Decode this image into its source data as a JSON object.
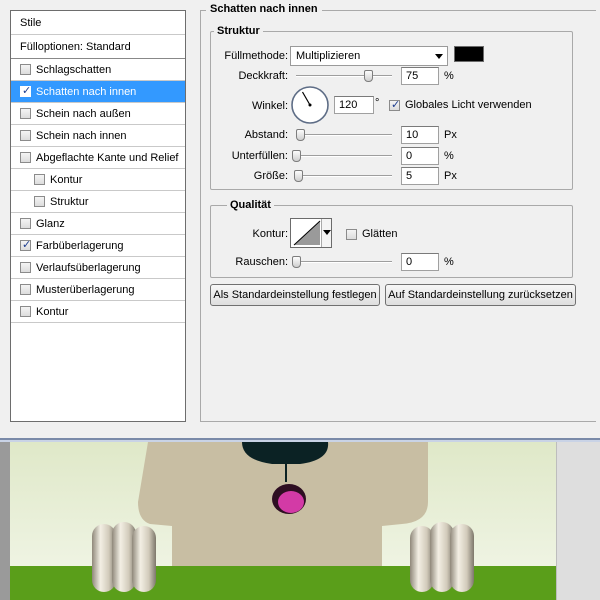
{
  "styles_panel": {
    "header": "Stile",
    "fill_options": "Fülloptionen: Standard",
    "items": [
      {
        "label": "Schlagschatten",
        "checked": false,
        "selected": false,
        "sub": false
      },
      {
        "label": "Schatten nach innen",
        "checked": true,
        "selected": true,
        "sub": false
      },
      {
        "label": "Schein nach außen",
        "checked": false,
        "selected": false,
        "sub": false
      },
      {
        "label": "Schein nach innen",
        "checked": false,
        "selected": false,
        "sub": false
      },
      {
        "label": "Abgeflachte Kante und Relief",
        "checked": false,
        "selected": false,
        "sub": false
      },
      {
        "label": "Kontur",
        "checked": false,
        "selected": false,
        "sub": true
      },
      {
        "label": "Struktur",
        "checked": false,
        "selected": false,
        "sub": true
      },
      {
        "label": "Glanz",
        "checked": false,
        "selected": false,
        "sub": false
      },
      {
        "label": "Farbüberlagerung",
        "checked": true,
        "selected": false,
        "sub": false
      },
      {
        "label": "Verlaufsüberlagerung",
        "checked": false,
        "selected": false,
        "sub": false
      },
      {
        "label": "Musterüberlagerung",
        "checked": false,
        "selected": false,
        "sub": false
      },
      {
        "label": "Kontur",
        "checked": false,
        "selected": false,
        "sub": false
      }
    ]
  },
  "inner_shadow": {
    "title": "Schatten nach innen",
    "structure": {
      "title": "Struktur",
      "blend_mode_label": "Füllmethode:",
      "blend_mode_value": "Multiplizieren",
      "shadow_color": "#000000",
      "opacity_label": "Deckkraft:",
      "opacity_value": "75",
      "opacity_unit": "%",
      "opacity_fraction": 0.75,
      "angle_label": "Winkel:",
      "angle_value": "120",
      "angle_unit": "°",
      "angle_degrees": 120,
      "global_light_label": "Globales Licht verwenden",
      "global_light_checked": true,
      "distance_label": "Abstand:",
      "distance_value": "10",
      "distance_unit": "Px",
      "distance_fraction": 0.04,
      "choke_label": "Unterfüllen:",
      "choke_value": "0",
      "choke_unit": "%",
      "choke_fraction": 0,
      "size_label": "Größe:",
      "size_value": "5",
      "size_unit": "Px",
      "size_fraction": 0.02
    },
    "quality": {
      "title": "Qualität",
      "contour_label": "Kontur:",
      "antialias_label": "Glätten",
      "antialias_checked": false,
      "noise_label": "Rauschen:",
      "noise_value": "0",
      "noise_unit": "%",
      "noise_fraction": 0
    },
    "buttons": {
      "set_default": "Als Standardeinstellung festlegen",
      "reset_default": "Auf Standardeinstellung zurücksetzen"
    }
  },
  "colors": {
    "selection": "#3399ff",
    "grass": "#5a9e1a",
    "sky": "#eef4de",
    "face": "#c8bea3",
    "nose": "#0b2224",
    "tongue": "#d33aa6"
  }
}
